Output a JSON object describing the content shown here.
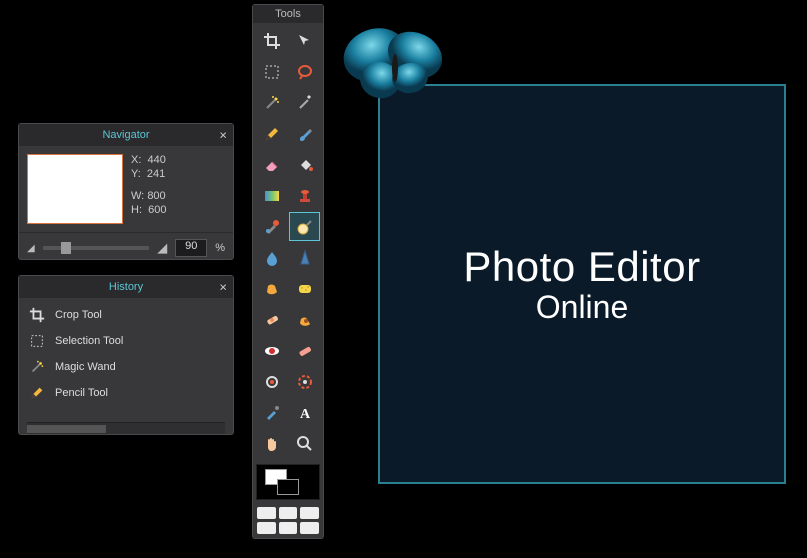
{
  "tools_panel": {
    "title": "Tools",
    "selected_index": 13,
    "items": [
      {
        "name": "crop-icon",
        "label": "Crop"
      },
      {
        "name": "move-icon",
        "label": "Move"
      },
      {
        "name": "marquee-icon",
        "label": "Marquee"
      },
      {
        "name": "lasso-icon",
        "label": "Lasso"
      },
      {
        "name": "wand-icon",
        "label": "Magic Wand"
      },
      {
        "name": "wand-alt-icon",
        "label": "Quick Select"
      },
      {
        "name": "pencil-icon",
        "label": "Pencil"
      },
      {
        "name": "brush-icon",
        "label": "Brush"
      },
      {
        "name": "eraser-icon",
        "label": "Eraser"
      },
      {
        "name": "fill-icon",
        "label": "Paint Bucket"
      },
      {
        "name": "gradient-icon",
        "label": "Gradient"
      },
      {
        "name": "stamp-icon",
        "label": "Clone Stamp"
      },
      {
        "name": "color-replace-icon",
        "label": "Color Replace"
      },
      {
        "name": "dodge-icon",
        "label": "Dodge"
      },
      {
        "name": "blur-icon",
        "label": "Blur"
      },
      {
        "name": "sharpen-icon",
        "label": "Sharpen"
      },
      {
        "name": "smudge-icon",
        "label": "Smudge"
      },
      {
        "name": "sponge-icon",
        "label": "Sponge"
      },
      {
        "name": "heal-icon",
        "label": "Healing"
      },
      {
        "name": "burn-icon",
        "label": "Burn"
      },
      {
        "name": "redeye-icon",
        "label": "Red Eye"
      },
      {
        "name": "spot-heal-icon",
        "label": "Spot Heal"
      },
      {
        "name": "pinch-icon",
        "label": "Pinch"
      },
      {
        "name": "liquify-icon",
        "label": "Liquify"
      },
      {
        "name": "eyedropper-icon",
        "label": "Eyedropper"
      },
      {
        "name": "type-icon",
        "label": "Type"
      },
      {
        "name": "hand-icon",
        "label": "Hand"
      },
      {
        "name": "zoom-icon",
        "label": "Zoom"
      }
    ]
  },
  "navigator": {
    "title": "Navigator",
    "x_label": "X:",
    "x_value": "440",
    "y_label": "Y:",
    "y_value": "241",
    "w_label": "W:",
    "w_value": "800",
    "h_label": "H:",
    "h_value": "600",
    "zoom_value": "90",
    "zoom_symbol": "%"
  },
  "history": {
    "title": "History",
    "items": [
      {
        "icon": "crop-icon",
        "label": "Crop Tool"
      },
      {
        "icon": "marquee-icon",
        "label": "Selection Tool"
      },
      {
        "icon": "wand-icon",
        "label": "Magic Wand"
      },
      {
        "icon": "pencil-icon",
        "label": "Pencil Tool"
      }
    ]
  },
  "branding": {
    "title": "Photo Editor",
    "subtitle": "Online"
  },
  "colors": {
    "accent": "#5cc5d6",
    "panel_bg": "#38383a",
    "brand_bg": "#0a1a28",
    "brand_border": "#2a8090"
  }
}
